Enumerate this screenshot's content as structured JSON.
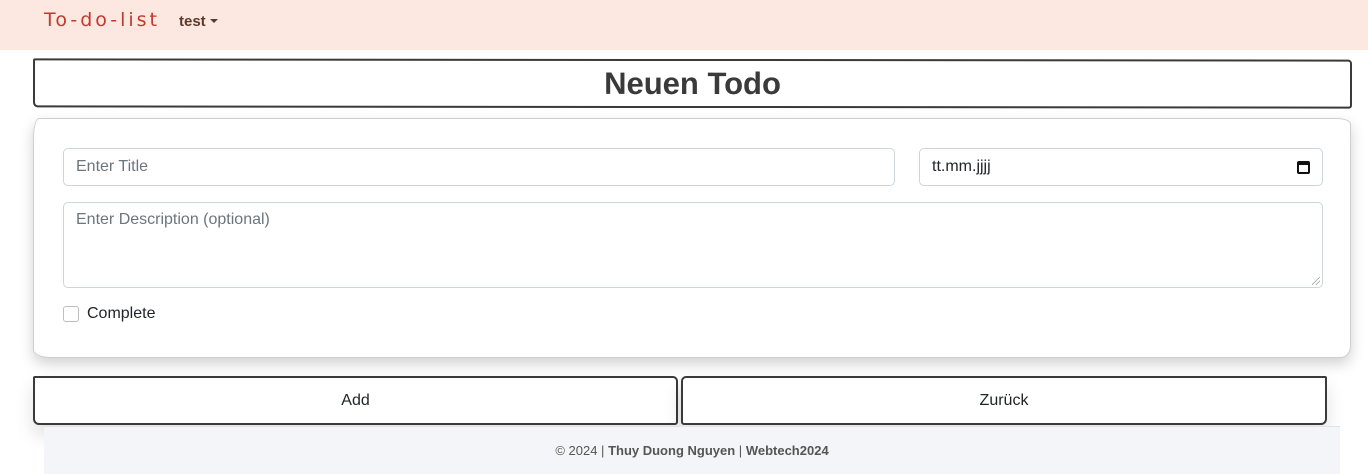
{
  "navbar": {
    "brand": "To-do-list",
    "user": "test"
  },
  "page": {
    "title": "Neuen Todo"
  },
  "form": {
    "title_placeholder": "Enter Title",
    "date_value": "tt.mm.jjjj",
    "description_placeholder": "Enter Description (optional)",
    "complete_label": "Complete"
  },
  "buttons": {
    "add": "Add",
    "back": "Zurück"
  },
  "footer": {
    "copyright": "© 2024 |",
    "author": "Thuy Duong Nguyen",
    "separator": "|",
    "project": "Webtech2024"
  },
  "colors": {
    "navbar_bg": "#fde8e1",
    "brand": "#c0392b"
  }
}
